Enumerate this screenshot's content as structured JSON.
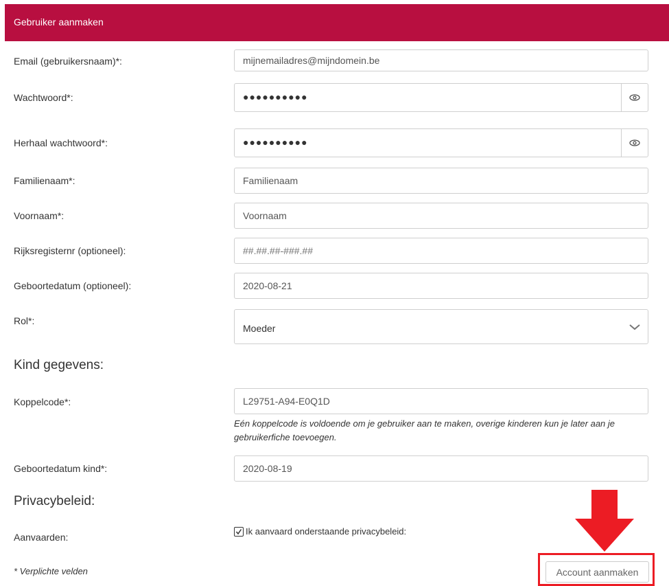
{
  "header": {
    "title": "Gebruiker aanmaken"
  },
  "form": {
    "email": {
      "label": "Email (gebruikersnaam)*:",
      "value": "mijnemailadres@mijndomein.be"
    },
    "password": {
      "label": "Wachtwoord*:",
      "masked": "●●●●●●●●●●"
    },
    "password_repeat": {
      "label": "Herhaal wachtwoord*:",
      "masked": "●●●●●●●●●●"
    },
    "last_name": {
      "label": "Familienaam*:",
      "value": "Familienaam"
    },
    "first_name": {
      "label": "Voornaam*:",
      "value": "Voornaam"
    },
    "national_id": {
      "label": "Rijksregisternr (optioneel):",
      "placeholder": "##.##.##-###.##"
    },
    "birthdate": {
      "label": "Geboortedatum (optioneel):",
      "value": "2020-08-21"
    },
    "role": {
      "label": "Rol*:",
      "selected": "Moeder"
    }
  },
  "child": {
    "heading": "Kind gegevens:",
    "code": {
      "label": "Koppelcode*:",
      "value": "L29751-A94-E0Q1D"
    },
    "hint": "Eén koppelcode is voldoende om je gebruiker aan te maken, overige kinderen kun je later aan je gebruikerfiche toevoegen.",
    "birthdate": {
      "label": "Geboortedatum kind*:",
      "value": "2020-08-19"
    }
  },
  "privacy": {
    "heading": "Privacybeleid:",
    "accept_label": "Aanvaarden:",
    "checkbox_label": "Ik aanvaard onderstaande privacybeleid:",
    "checked": true
  },
  "footer": {
    "required_note": "* Verplichte velden",
    "submit_label": "Account aanmaken"
  },
  "colors": {
    "header": "#b80f40",
    "annotation": "#ec1c24"
  },
  "icons": {
    "reveal": "eye-icon",
    "dropdown": "chevron-down-icon",
    "check": "checkmark-icon",
    "annotation": "arrow-down-icon"
  }
}
